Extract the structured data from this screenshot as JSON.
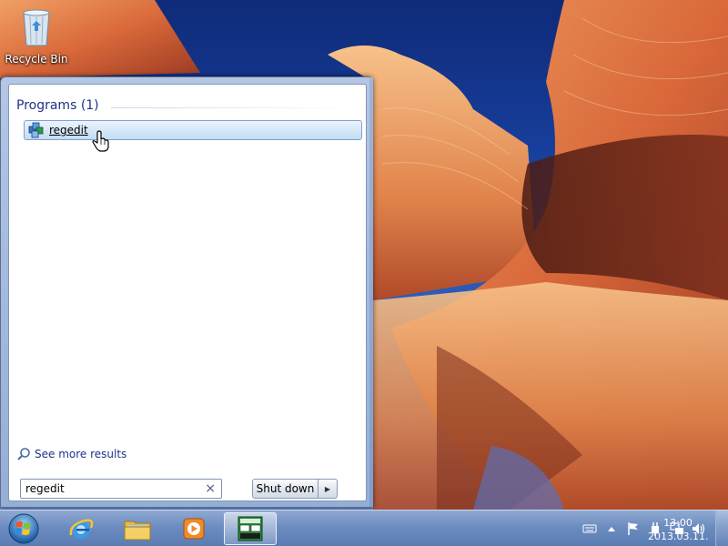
{
  "desktop": {
    "icons": [
      {
        "label": "Recycle Bin",
        "icon": "recycle-bin-icon"
      }
    ]
  },
  "start_menu": {
    "group_header": "Programs (1)",
    "results": [
      {
        "label": "regedit",
        "icon": "registry-editor-icon"
      }
    ],
    "see_more": "See more results",
    "search": {
      "value": "regedit",
      "clear_glyph": "×"
    },
    "shutdown_label": "Shut down",
    "shutdown_arrow_glyph": "▶"
  },
  "taskbar": {
    "start_icon": "windows-orb-icon",
    "pinned": [
      {
        "name": "Internet Explorer",
        "icon": "internet-explorer-icon"
      },
      {
        "name": "Windows Explorer",
        "icon": "folder-icon"
      },
      {
        "name": "Windows Media Player",
        "icon": "media-player-icon"
      },
      {
        "name": "Application",
        "icon": "app-window-icon",
        "active": true
      }
    ],
    "tray": {
      "icons": [
        "keyboard-icon",
        "show-hidden-icons-arrow",
        "action-center-flag-icon",
        "power-plug-icon",
        "network-icon",
        "volume-icon"
      ],
      "time": "13:00",
      "date": "2013.03.11."
    }
  },
  "colors": {
    "group_header": "#1e3287",
    "selection_border": "#7da2ce",
    "taskbar": "#6d8dc0"
  }
}
